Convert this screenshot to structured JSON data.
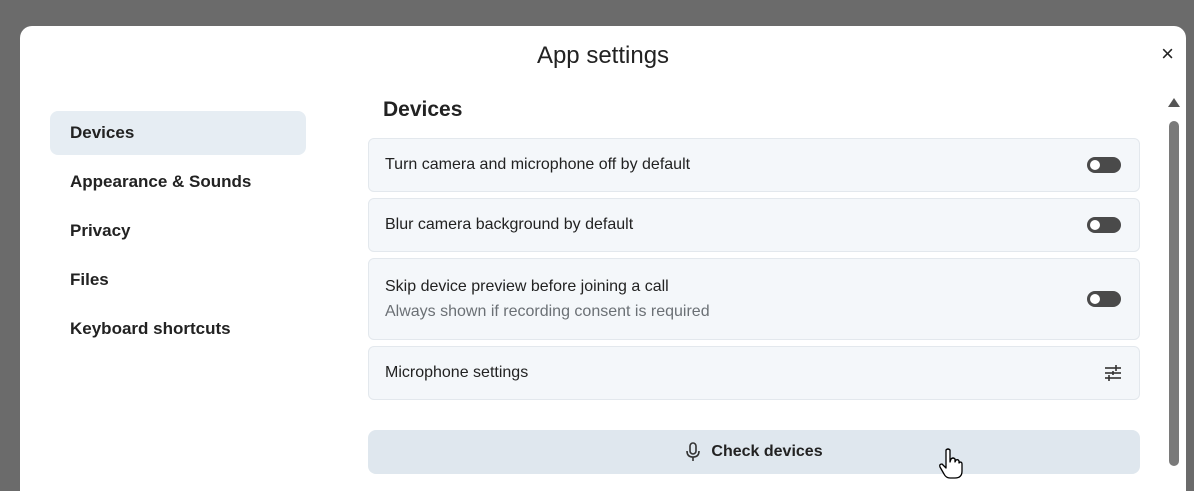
{
  "dialog": {
    "title": "App settings",
    "close_glyph": "×"
  },
  "nav": {
    "items": [
      {
        "label": "Devices",
        "active": true
      },
      {
        "label": "Appearance & Sounds",
        "active": false
      },
      {
        "label": "Privacy",
        "active": false
      },
      {
        "label": "Files",
        "active": false
      },
      {
        "label": "Keyboard shortcuts",
        "active": false
      }
    ]
  },
  "devices": {
    "section_title": "Devices",
    "settings": [
      {
        "label": "Turn camera and microphone off by default",
        "control": "toggle",
        "value": "off"
      },
      {
        "label": "Blur camera background by default",
        "control": "toggle",
        "value": "off"
      },
      {
        "label": "Skip device preview before joining a call",
        "sublabel": "Always shown if recording consent is required",
        "control": "toggle",
        "value": "off"
      },
      {
        "label": "Microphone settings",
        "control": "tune-icon"
      }
    ],
    "check_button": {
      "label": "Check devices",
      "icon": "microphone-icon"
    }
  },
  "colors": {
    "overlay": "#6b6b6b",
    "active_nav": "#e6edf3",
    "row_bg": "#f4f7fa",
    "button_bg": "#dfe7ee",
    "toggle": "#4a4a4a"
  }
}
